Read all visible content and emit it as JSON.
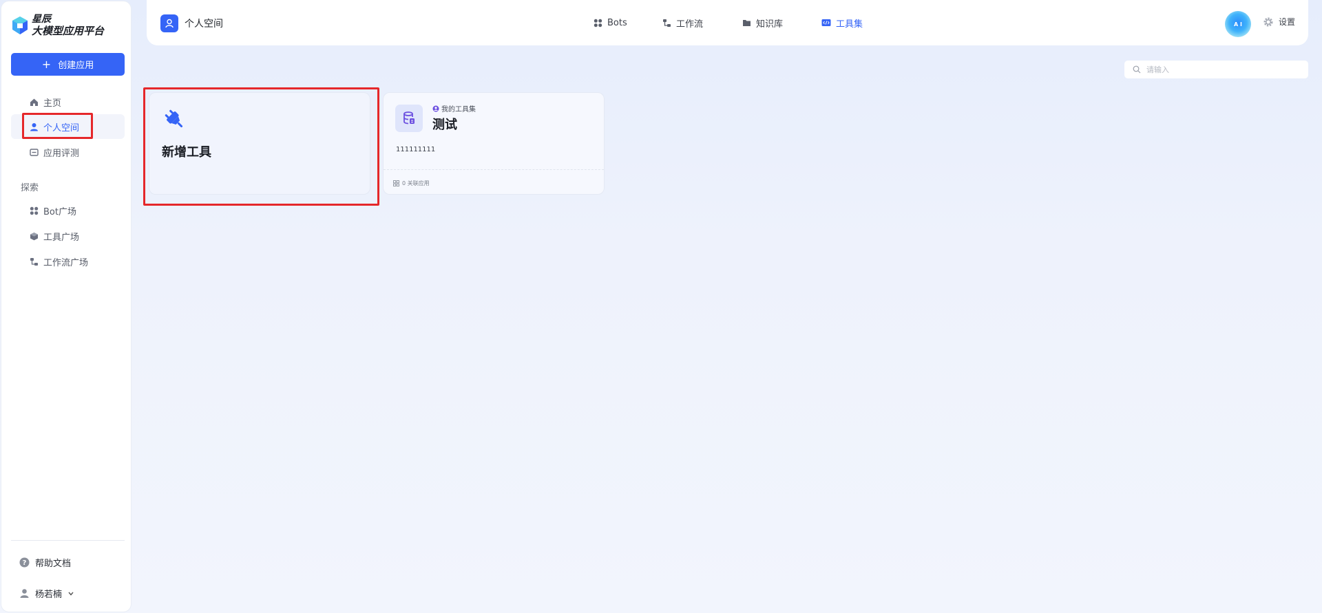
{
  "brand": {
    "line1": "星辰",
    "line2": "大模型应用平台",
    "accent": "#3564f6"
  },
  "sidebar": {
    "create_label": "创建应用",
    "items": [
      {
        "label": "主页",
        "icon": "home-icon",
        "active": false
      },
      {
        "label": "个人空间",
        "icon": "user-icon",
        "active": true
      },
      {
        "label": "应用评测",
        "icon": "evaluation-icon",
        "active": false
      }
    ],
    "explore_label": "探索",
    "explore_items": [
      {
        "label": "Bot广场",
        "icon": "apps-grid-icon"
      },
      {
        "label": "工具广场",
        "icon": "cube-icon"
      },
      {
        "label": "工作流广场",
        "icon": "workflow-icon"
      }
    ],
    "help_label": "帮助文档",
    "user_name": "杨若楠"
  },
  "header": {
    "space_title": "个人空间",
    "tabs": [
      {
        "label": "Bots",
        "icon": "apps-grid-icon",
        "active": false
      },
      {
        "label": "工作流",
        "icon": "workflow-icon",
        "active": false
      },
      {
        "label": "知识库",
        "icon": "folder-icon",
        "active": false
      },
      {
        "label": "工具集",
        "icon": "code-icon",
        "active": true
      }
    ],
    "avatar_text": "A I",
    "settings_label": "设置"
  },
  "search": {
    "placeholder": "请输入"
  },
  "cards": {
    "add_tool": {
      "title": "新增工具"
    },
    "tool": {
      "collection_label": "我的工具集",
      "name": "测试",
      "description": "111111111",
      "footer": "0 关联应用"
    }
  }
}
